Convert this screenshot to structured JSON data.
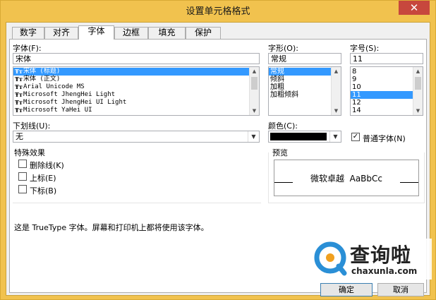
{
  "window": {
    "title": "设置单元格格式",
    "close_glyph": "✕"
  },
  "tabs": [
    {
      "label": "数字"
    },
    {
      "label": "对齐"
    },
    {
      "label": "字体"
    },
    {
      "label": "边框"
    },
    {
      "label": "填充"
    },
    {
      "label": "保护"
    }
  ],
  "font": {
    "label": "字体(F):",
    "value": "宋体",
    "items": [
      {
        "label": "宋体 (标题)",
        "type_glyph": "Ŧт",
        "selected": true
      },
      {
        "label": "宋体 (正文)",
        "type_glyph": "Ŧт"
      },
      {
        "label": "Arial Unicode MS",
        "type_glyph": "Ŧт"
      },
      {
        "label": "Microsoft JhengHei Light",
        "type_glyph": "Ŧт"
      },
      {
        "label": "Microsoft JhengHei UI Light",
        "type_glyph": "Ŧт"
      },
      {
        "label": "Microsoft YaHei UI",
        "type_glyph": "Ŧт"
      }
    ]
  },
  "style": {
    "label": "字形(O):",
    "value": "常规",
    "items": [
      {
        "label": "常规",
        "selected": true
      },
      {
        "label": "倾斜"
      },
      {
        "label": "加粗"
      },
      {
        "label": "加粗倾斜"
      }
    ]
  },
  "size": {
    "label": "字号(S):",
    "value": "11",
    "items": [
      {
        "label": "8"
      },
      {
        "label": "9"
      },
      {
        "label": "10"
      },
      {
        "label": "11",
        "selected": true
      },
      {
        "label": "12"
      },
      {
        "label": "14"
      }
    ]
  },
  "underline": {
    "label": "下划线(U):",
    "value": "无"
  },
  "color": {
    "label": "颜色(C):",
    "swatch": "#000000"
  },
  "normal_font": {
    "label": "普通字体(N)",
    "checked": true,
    "check_glyph": "✓"
  },
  "effects": {
    "label": "特殊效果",
    "items": [
      {
        "label": "删除线(K)",
        "checked": false
      },
      {
        "label": "上标(E)",
        "checked": false
      },
      {
        "label": "下标(B)",
        "checked": false
      }
    ]
  },
  "preview": {
    "label": "预览",
    "sample": "微软卓越  AaBbCc"
  },
  "description": "这是 TrueType 字体。屏幕和打印机上都将使用该字体。",
  "buttons": {
    "ok": "确定",
    "cancel": "取消"
  },
  "glyphs": {
    "up": "▲",
    "down": "▼",
    "combo_down": "▼"
  },
  "watermark": {
    "text": "查询啦",
    "url": "chaxunla.com",
    "logo_color": "#2a8fd6"
  }
}
